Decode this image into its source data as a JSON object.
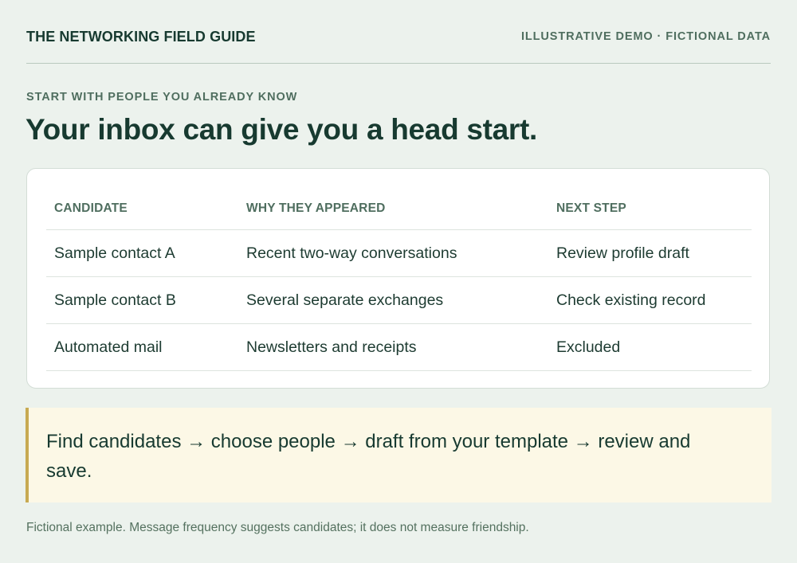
{
  "header": {
    "brand": "THE NETWORKING FIELD GUIDE",
    "tagline": "ILLUSTRATIVE DEMO · FICTIONAL DATA"
  },
  "section": {
    "eyebrow": "START WITH PEOPLE YOU ALREADY KNOW",
    "headline": "Your inbox can give you a head start."
  },
  "table": {
    "columns": [
      "CANDIDATE",
      "WHY THEY APPEARED",
      "NEXT STEP"
    ],
    "rows": [
      [
        "Sample contact A",
        "Recent two-way conversations",
        "Review profile draft"
      ],
      [
        "Sample contact B",
        "Several separate exchanges",
        "Check existing record"
      ],
      [
        "Automated mail",
        "Newsletters and receipts",
        "Excluded"
      ]
    ]
  },
  "callout": {
    "text": "Find candidates → choose people → draft from your template → review and save."
  },
  "footnote": "Fictional example. Message frequency suggests candidates; it does not measure friendship.",
  "colors": {
    "background": "#ecf2ed",
    "text": "#173a30",
    "muted": "#4f6e5f",
    "callout_background": "#fcf8e6",
    "callout_accent": "#c8aa52"
  }
}
